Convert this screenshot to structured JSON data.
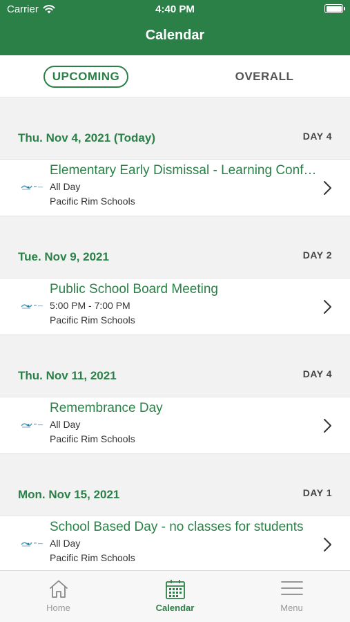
{
  "status": {
    "carrier": "Carrier",
    "time": "4:40 PM"
  },
  "nav": {
    "title": "Calendar"
  },
  "segments": {
    "upcoming": "UPCOMING",
    "overall": "OVERALL"
  },
  "days": [
    {
      "date": "Thu. Nov 4, 2021 (Today)",
      "day": "DAY 4",
      "event": {
        "title": "Elementary Early Dismissal - Learning Conferences",
        "time": "All Day",
        "org": "Pacific Rim Schools"
      }
    },
    {
      "date": "Tue. Nov 9, 2021",
      "day": "DAY 2",
      "event": {
        "title": "Public School Board Meeting",
        "time": "5:00 PM - 7:00 PM",
        "org": "Pacific Rim Schools"
      }
    },
    {
      "date": "Thu. Nov 11, 2021",
      "day": "DAY 4",
      "event": {
        "title": "Remembrance Day",
        "time": "All Day",
        "org": "Pacific Rim Schools"
      }
    },
    {
      "date": "Mon. Nov 15, 2021",
      "day": "DAY 1",
      "event": {
        "title": "School Based Day - no classes for students",
        "time": "All Day",
        "org": "Pacific Rim Schools"
      }
    }
  ],
  "tabs": {
    "home": "Home",
    "calendar": "Calendar",
    "menu": "Menu"
  },
  "colors": {
    "brand": "#2b8047"
  },
  "icons": {
    "signal": "wifi-icon",
    "battery": "battery-icon",
    "logo": "school-logo-icon",
    "chevron": "chevron-right-icon",
    "home": "home-icon",
    "calendar": "calendar-icon",
    "menu": "menu-icon"
  }
}
